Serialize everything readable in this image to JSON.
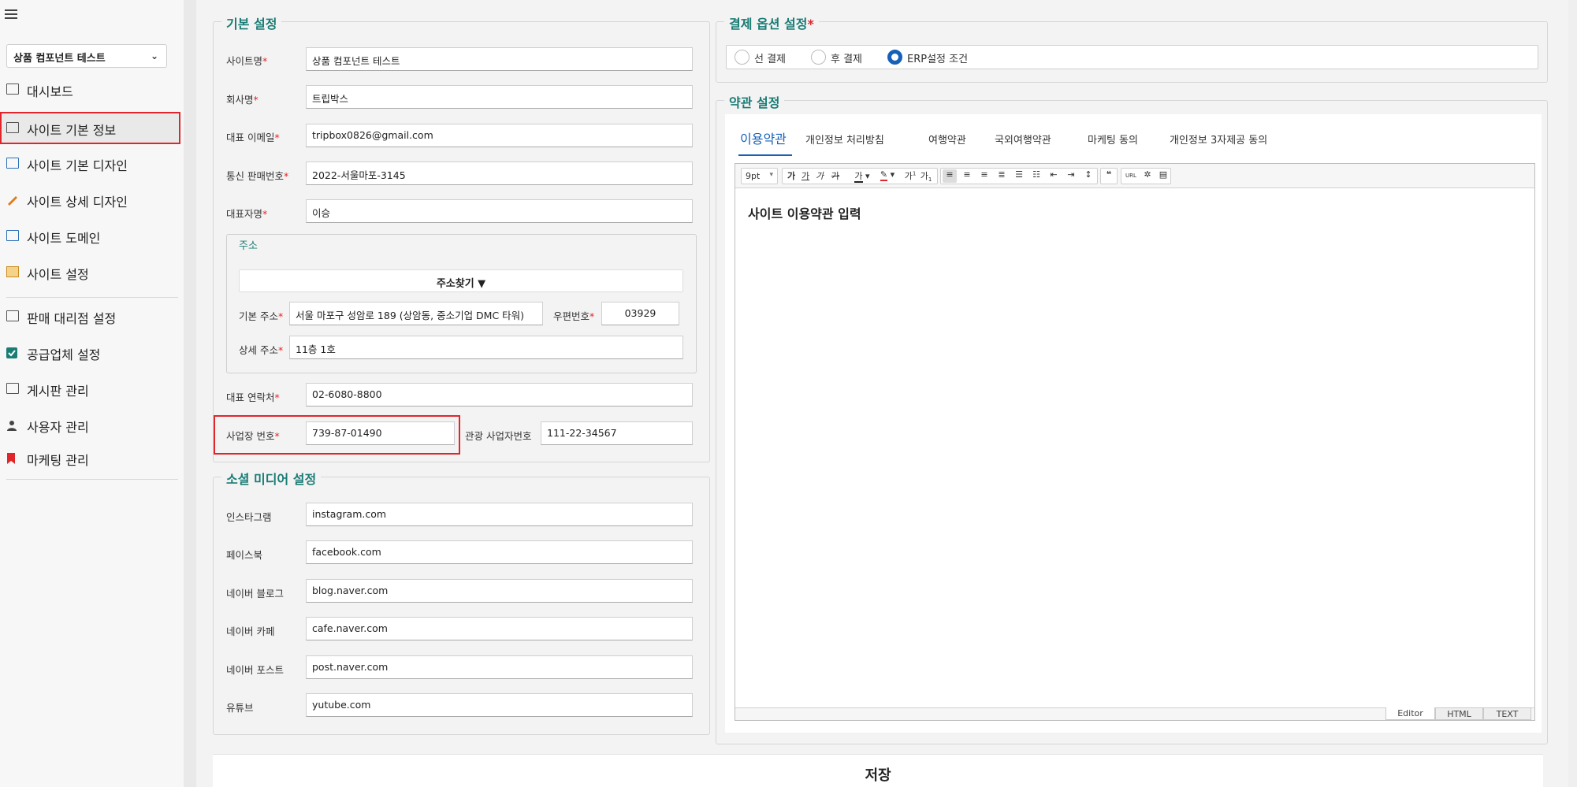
{
  "sidebar": {
    "site_selector": "상품 컴포넌트 테스트",
    "items": [
      {
        "label": "대시보드"
      },
      {
        "label": "사이트 기본 정보"
      },
      {
        "label": "사이트 기본 디자인"
      },
      {
        "label": "사이트 상세 디자인"
      },
      {
        "label": "사이트 도메인"
      },
      {
        "label": "사이트 설정"
      },
      {
        "label": "판매 대리점 설정"
      },
      {
        "label": "공급업체 설정"
      },
      {
        "label": "게시판 관리"
      },
      {
        "label": "사용자 관리"
      },
      {
        "label": "마케팅 관리"
      }
    ]
  },
  "basic": {
    "title": "기본 설정",
    "site_name": {
      "label": "사이트명",
      "value": "상품 컴포넌트 테스트"
    },
    "company": {
      "label": "회사명",
      "value": "트립박스"
    },
    "email": {
      "label": "대표 이메일",
      "value": "tripbox0826@gmail.com"
    },
    "mail_order": {
      "label": "통신 판매번호",
      "value": "2022-서울마포-3145"
    },
    "ceo": {
      "label": "대표자명",
      "value": "이승"
    },
    "address": {
      "title": "주소",
      "find_button": "주소찾기 ▼",
      "base": {
        "label": "기본 주소",
        "value": "서울 마포구 성암로 189 (상암동, 중소기업 DMC 타워)"
      },
      "zip": {
        "label": "우편번호",
        "value": "03929"
      },
      "detail": {
        "label": "상세 주소",
        "value": "11층 1호"
      }
    },
    "phone": {
      "label": "대표 연락처",
      "value": "02-6080-8800"
    },
    "biz_no": {
      "label": "사업장 번호",
      "value": "739-87-01490"
    },
    "tour_no": {
      "label": "관광 사업자번호",
      "value": "111-22-34567"
    }
  },
  "social": {
    "title": "소셜 미디어 설정",
    "instagram": {
      "label": "인스타그램",
      "value": "instagram.com"
    },
    "facebook": {
      "label": "페이스북",
      "value": "facebook.com"
    },
    "naver_blog": {
      "label": "네이버 블로그",
      "value": "blog.naver.com"
    },
    "naver_cafe": {
      "label": "네이버 카페",
      "value": "cafe.naver.com"
    },
    "naver_post": {
      "label": "네이버 포스트",
      "value": "post.naver.com"
    },
    "youtube": {
      "label": "유튜브",
      "value": "yutube.com"
    }
  },
  "payment": {
    "title": "결제 옵션 설정",
    "options": [
      "선 결제",
      "후 결제",
      "ERP설정 조건"
    ],
    "selected": "ERP설정 조건"
  },
  "terms": {
    "title": "약관 설정",
    "tabs": [
      "이용약관",
      "개인정보 처리방침",
      "여행약관",
      "국외여행약관",
      "마케팅 동의",
      "개인정보 3자제공 동의"
    ],
    "active_tab": "이용약관",
    "font_size": "9pt",
    "body": "사이트 이용약관 입력",
    "modes": [
      "Editor",
      "HTML",
      "TEXT"
    ],
    "toolbar": {
      "url": "URL"
    }
  },
  "save_label": "저장",
  "colors": {
    "accent": "#1a7c75",
    "primary": "#1661b8",
    "required": "#e0262b"
  }
}
